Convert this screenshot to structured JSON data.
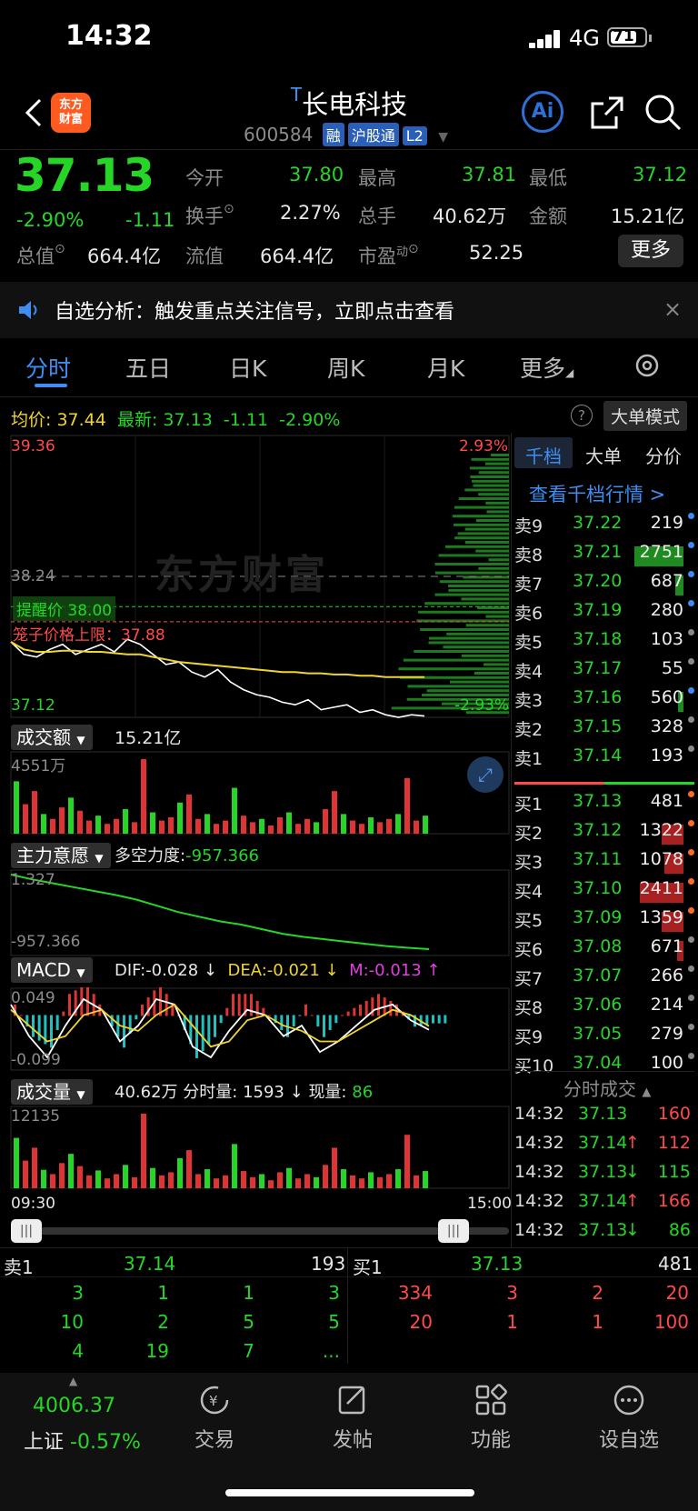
{
  "status": {
    "time": "14:32",
    "network": "4G",
    "battery": "71"
  },
  "header": {
    "logo_line1": "东方",
    "logo_line2": "财富",
    "title_mark": "T",
    "title": "长电科技",
    "code": "600584",
    "tags": [
      "融",
      "沪股通",
      "L2"
    ],
    "ai_label": "Ai"
  },
  "quote": {
    "price": "37.13",
    "change_pct": "-2.90%",
    "change": "-1.11",
    "open_label": "今开",
    "open": "37.80",
    "high_label": "最高",
    "high": "37.81",
    "low_label": "最低",
    "low": "37.12",
    "turnover_label": "换手",
    "turnover": "2.27%",
    "volume_label": "总手",
    "volume": "40.62万",
    "amount_label": "金额",
    "amount": "15.21亿",
    "mktcap_label": "总值",
    "mktcap": "664.4亿",
    "float_label": "流值",
    "float": "664.4亿",
    "pe_label": "市盈",
    "pe_sup": "动",
    "pe": "52.25",
    "more": "更多"
  },
  "notice": {
    "text": "自选分析：触发重点关注信号，立即点击查看"
  },
  "tabs": [
    {
      "label": "分时",
      "active": true
    },
    {
      "label": "五日"
    },
    {
      "label": "日K"
    },
    {
      "label": "周K"
    },
    {
      "label": "月K"
    },
    {
      "label": "更多"
    }
  ],
  "chart_info": {
    "avg_label": "均价:",
    "avg": "37.44",
    "latest_label": "最新:",
    "latest": "37.13",
    "latest_chg": "-1.11",
    "latest_pct": "-2.90%",
    "big_mode": "大单模式",
    "y_top": "39.36",
    "y_mid": "38.24",
    "y_bot": "37.12",
    "pct_top": "2.93%",
    "pct_bot": "-2.93%",
    "watermark": "东方财富",
    "alert_label": "提醒价 38.00",
    "cage_label": "笼子价格上限：37.88",
    "time_start": "09:30",
    "time_end": "15:00"
  },
  "chart_data": [
    {
      "type": "line",
      "title": "分时",
      "x_range": [
        "09:30",
        "15:00"
      ],
      "ylim": [
        37.12,
        39.36
      ],
      "series": [
        {
          "name": "最新",
          "color": "#ffffff",
          "values": [
            37.72,
            37.62,
            37.6,
            37.66,
            37.7,
            37.62,
            37.66,
            37.7,
            37.64,
            37.74,
            37.7,
            37.62,
            37.54,
            37.56,
            37.48,
            37.44,
            37.5,
            37.4,
            37.34,
            37.3,
            37.28,
            37.24,
            37.22,
            37.26,
            37.18,
            37.2,
            37.22,
            37.16,
            37.18,
            37.14,
            37.12,
            37.14,
            37.13
          ]
        },
        {
          "name": "均价",
          "color": "#f0d430",
          "values": [
            37.72,
            37.66,
            37.64,
            37.64,
            37.65,
            37.65,
            37.64,
            37.64,
            37.63,
            37.62,
            37.62,
            37.6,
            37.58,
            37.56,
            37.55,
            37.54,
            37.53,
            37.52,
            37.51,
            37.5,
            37.49,
            37.48,
            37.48,
            37.47,
            37.47,
            37.46,
            37.46,
            37.45,
            37.45,
            37.44,
            37.44,
            37.44,
            37.44
          ]
        }
      ],
      "reference_lines": {
        "alert_price": 38.0,
        "cage_upper": 37.88,
        "prev_close": 38.24
      }
    },
    {
      "type": "bar",
      "title": "成交额",
      "unit": "万",
      "ylim": [
        0,
        4551
      ],
      "values": [
        3200,
        1800,
        2600,
        1200,
        900,
        1600,
        2200,
        1400,
        800,
        1100,
        600,
        900,
        1500,
        700,
        4551,
        1300,
        800,
        1000,
        1900,
        2400,
        900,
        1200,
        600,
        800,
        2800,
        1100,
        700,
        900,
        500,
        1000,
        1300,
        600,
        900,
        700,
        1500,
        2600,
        1200,
        800,
        600,
        1000,
        700,
        900,
        1200,
        3400,
        800,
        1100
      ]
    },
    {
      "type": "line",
      "title": "主力意愿",
      "ylim": [
        -957.366,
        1.327
      ],
      "values": [
        1.3,
        -60,
        -110,
        -160,
        -210,
        -260,
        -320,
        -400,
        -480,
        -540,
        -600,
        -640,
        -700,
        -760,
        -800,
        -830,
        -860,
        -890,
        -920,
        -940,
        -957.366
      ]
    },
    {
      "type": "bar",
      "title": "MACD",
      "ylim": [
        -0.099,
        0.049
      ],
      "series": [
        {
          "name": "DIF",
          "values": [
            0.02,
            -0.04,
            -0.08,
            -0.02,
            0.03,
            0.01,
            -0.05,
            -0.02,
            0.03,
            0.02,
            -0.06,
            -0.08,
            -0.03,
            0.01,
            0.0,
            -0.04,
            -0.02,
            -0.07,
            -0.05,
            -0.02,
            0.01,
            0.02,
            -0.01,
            -0.028
          ]
        },
        {
          "name": "DEA",
          "values": [
            0.01,
            -0.02,
            -0.05,
            -0.04,
            0.0,
            0.01,
            -0.02,
            -0.03,
            0.0,
            0.02,
            -0.02,
            -0.06,
            -0.05,
            -0.01,
            0.0,
            -0.02,
            -0.03,
            -0.05,
            -0.05,
            -0.03,
            -0.01,
            0.01,
            0.0,
            -0.021
          ]
        }
      ]
    },
    {
      "type": "bar",
      "title": "成交量",
      "ylim": [
        0,
        12135
      ],
      "values": [
        8200,
        4500,
        6600,
        3000,
        2300,
        4100,
        5600,
        3600,
        2100,
        2900,
        1600,
        2300,
        3800,
        1800,
        12135,
        3300,
        2100,
        2600,
        4900,
        6200,
        2300,
        3100,
        1600,
        2100,
        7200,
        2800,
        1800,
        2300,
        1300,
        2600,
        3300,
        1600,
        2300,
        1800,
        3800,
        6600,
        3100,
        2100,
        1600,
        2600,
        1800,
        2300,
        3100,
        8700,
        2100,
        2800
      ]
    }
  ],
  "indicators": {
    "amount_sel": "成交额",
    "amount_val": "15.21亿",
    "amount_max": "4551万",
    "force_sel": "主力意愿",
    "force_label": "多空力度:",
    "force_val": "-957.366",
    "force_top": "1.327",
    "force_bot": "-957.366",
    "macd_sel": "MACD",
    "dif": "DIF:-0.028 ↓",
    "dea": "DEA:-0.021 ↓",
    "m": "M:-0.013 ↑",
    "macd_top": "0.049",
    "macd_bot": "-0.099",
    "vol_sel": "成交量",
    "vol_total": "40.62万",
    "vol_min_label": "分时量:",
    "vol_min": "1593 ↓",
    "vol_now_label": "现量:",
    "vol_now": "86",
    "vol_max": "12135"
  },
  "orderbook": {
    "tabs": [
      "千档",
      "大单",
      "分价"
    ],
    "link": "查看千档行情 >",
    "asks": [
      {
        "label": "卖9",
        "price": "37.22",
        "vol": "219",
        "dot": "#3d8ef0"
      },
      {
        "label": "卖8",
        "price": "37.21",
        "vol": "2751",
        "dot": "#3d8ef0",
        "bar": 0.9
      },
      {
        "label": "卖7",
        "price": "37.20",
        "vol": "687",
        "dot": "#3d8ef0",
        "bar": 0.15
      },
      {
        "label": "卖6",
        "price": "37.19",
        "vol": "280",
        "dot": "#3d8ef0"
      },
      {
        "label": "卖5",
        "price": "37.18",
        "vol": "103",
        "dot": "#888"
      },
      {
        "label": "卖4",
        "price": "37.17",
        "vol": "55",
        "dot": "#888"
      },
      {
        "label": "卖3",
        "price": "37.16",
        "vol": "560",
        "dot": "#3d8ef0",
        "bar": 0.1
      },
      {
        "label": "卖2",
        "price": "37.15",
        "vol": "328",
        "dot": "#888"
      },
      {
        "label": "卖1",
        "price": "37.14",
        "vol": "193",
        "dot": "#888"
      }
    ],
    "bids": [
      {
        "label": "买1",
        "price": "37.13",
        "vol": "481",
        "dot": "#ff6a2a"
      },
      {
        "label": "买2",
        "price": "37.12",
        "vol": "1322",
        "dot": "#ff6a2a",
        "bar": 0.4
      },
      {
        "label": "买3",
        "price": "37.11",
        "vol": "1078",
        "dot": "#ff6a2a",
        "bar": 0.35
      },
      {
        "label": "买4",
        "price": "37.10",
        "vol": "2411",
        "dot": "#ff6a2a",
        "bar": 0.8
      },
      {
        "label": "买5",
        "price": "37.09",
        "vol": "1359",
        "dot": "#ff6a2a",
        "bar": 0.4
      },
      {
        "label": "买6",
        "price": "37.08",
        "vol": "671",
        "dot": "#888",
        "bar": 0.12
      },
      {
        "label": "买7",
        "price": "37.07",
        "vol": "266",
        "dot": "#888"
      },
      {
        "label": "买8",
        "price": "37.06",
        "vol": "214",
        "dot": "#888"
      },
      {
        "label": "买9",
        "price": "37.05",
        "vol": "279",
        "dot": "#888"
      },
      {
        "label": "买10",
        "price": "37.04",
        "vol": "100",
        "dot": "#888"
      }
    ],
    "trades_title": "分时成交",
    "trades": [
      {
        "time": "14:32",
        "price": "37.13",
        "arrow": "",
        "vol": "160",
        "vol_color": "#ff4a4a"
      },
      {
        "time": "14:32",
        "price": "37.14",
        "arrow": "↑",
        "vol": "112",
        "vol_color": "#ff4a4a"
      },
      {
        "time": "14:32",
        "price": "37.13",
        "arrow": "↓",
        "vol": "115",
        "vol_color": "#26d626"
      },
      {
        "time": "14:32",
        "price": "37.14",
        "arrow": "↑",
        "vol": "166",
        "vol_color": "#ff4a4a"
      },
      {
        "time": "14:32",
        "price": "37.13",
        "arrow": "↓",
        "vol": "86",
        "vol_color": "#26d626"
      }
    ]
  },
  "queue": {
    "sell_label": "卖1",
    "sell_price": "37.14",
    "sell_vol": "193",
    "buy_label": "买1",
    "buy_price": "37.13",
    "buy_vol": "481",
    "sell_rows": [
      [
        "3",
        "1",
        "1",
        "3"
      ],
      [
        "10",
        "2",
        "5",
        "5"
      ],
      [
        "4",
        "19",
        "7",
        "..."
      ]
    ],
    "buy_rows": [
      [
        "334",
        "3",
        "2",
        "20"
      ],
      [
        "20",
        "1",
        "1",
        "100"
      ]
    ]
  },
  "nav": {
    "index_value": "4006.37",
    "index_name": "上证",
    "index_pct": "-0.57%",
    "items": [
      "交易",
      "发帖",
      "功能",
      "设自选"
    ]
  }
}
